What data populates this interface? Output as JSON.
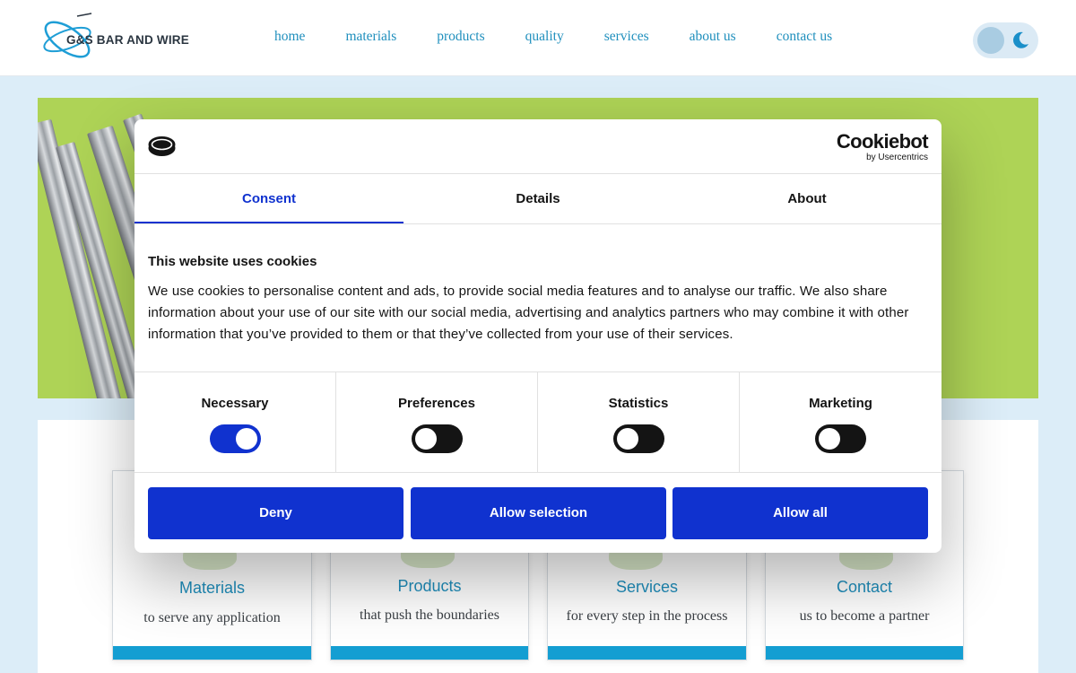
{
  "site": {
    "logo_text": "G&S BAR AND WIRE",
    "nav": [
      {
        "label": "home"
      },
      {
        "label": "materials"
      },
      {
        "label": "products"
      },
      {
        "label": "quality"
      },
      {
        "label": "services"
      },
      {
        "label": "about us"
      },
      {
        "label": "contact us"
      }
    ],
    "theme_toggle_icon": "moon-icon",
    "accent_color": "#1f8fbd"
  },
  "cards": [
    {
      "title": "Materials",
      "subtitle": "to serve any application"
    },
    {
      "title": "Products",
      "subtitle": "that push the boundaries"
    },
    {
      "title": "Services",
      "subtitle": "for every step in the process"
    },
    {
      "title": "Contact",
      "subtitle": "us to become a partner"
    }
  ],
  "cookie_dialog": {
    "brand_name": "Cookiebot",
    "brand_sub": "by Usercentrics",
    "tabs": [
      {
        "label": "Consent",
        "active": true
      },
      {
        "label": "Details",
        "active": false
      },
      {
        "label": "About",
        "active": false
      }
    ],
    "heading": "This website uses cookies",
    "body": "We use cookies to personalise content and ads, to provide social media features and to analyse our traffic. We also share information about your use of our site with our social media, advertising and analytics partners who may combine it with other information that you’ve provided to them or that they’ve collected from your use of their services.",
    "categories": [
      {
        "label": "Necessary",
        "enabled": true
      },
      {
        "label": "Preferences",
        "enabled": false
      },
      {
        "label": "Statistics",
        "enabled": false
      },
      {
        "label": "Marketing",
        "enabled": false
      }
    ],
    "buttons": {
      "deny": "Deny",
      "allow_selection": "Allow selection",
      "allow_all": "Allow all"
    },
    "primary_color": "#1032cf"
  }
}
